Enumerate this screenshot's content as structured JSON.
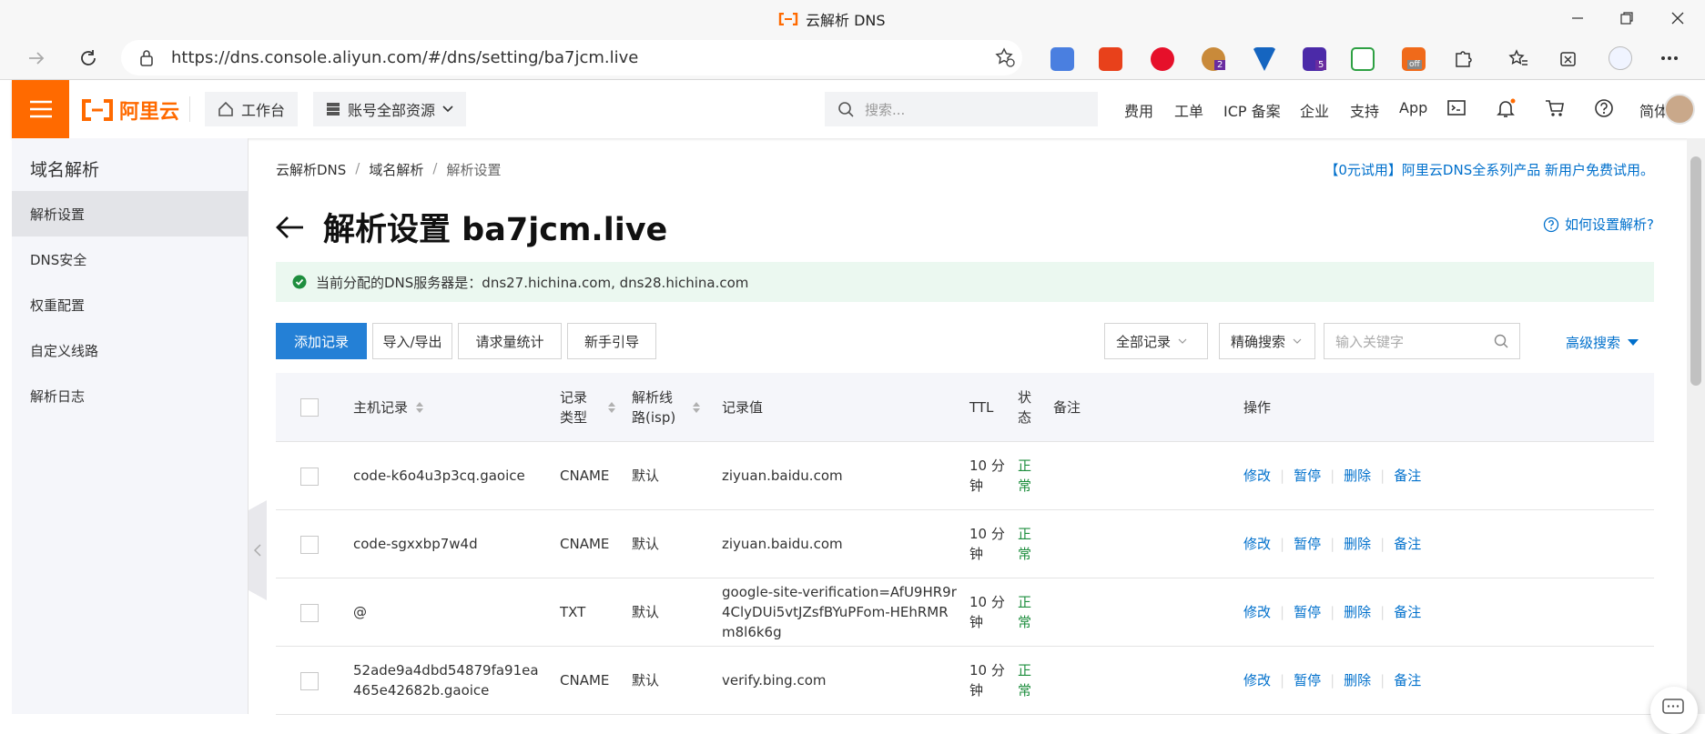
{
  "browser": {
    "window_title": "云解析 DNS",
    "url": "https://dns.console.aliyun.com/#/dns/setting/ba7jcm.live",
    "extension_badges": [
      "2",
      "5",
      "off"
    ]
  },
  "header": {
    "logo": "阿里云",
    "workbench": "工作台",
    "resources": "账号全部资源",
    "search_placeholder": "搜索...",
    "links": [
      "费用",
      "工单",
      "ICP 备案",
      "企业",
      "支持",
      "App"
    ],
    "language": "简体"
  },
  "sidebar": {
    "title": "域名解析",
    "items": [
      {
        "label": "解析设置",
        "active": true
      },
      {
        "label": "DNS安全",
        "active": false
      },
      {
        "label": "权重配置",
        "active": false
      },
      {
        "label": "自定义线路",
        "active": false
      },
      {
        "label": "解析日志",
        "active": false
      }
    ]
  },
  "breadcrumb": [
    "云解析DNS",
    "域名解析",
    "解析设置"
  ],
  "promo": "【0元试用】阿里云DNS全系列产品 新用户免费试用。",
  "page_title": "解析设置 ba7jcm.live",
  "help_link": "如何设置解析?",
  "dns_banner": "当前分配的DNS服务器是：dns27.hichina.com, dns28.hichina.com",
  "toolbar": {
    "add": "添加记录",
    "import_export": "导入/导出",
    "stats": "请求量统计",
    "guide": "新手引导",
    "filter_select": "全部记录",
    "match_select": "精确搜索",
    "keyword_placeholder": "输入关键字",
    "advanced": "高级搜索"
  },
  "table": {
    "headers": {
      "host": "主机记录",
      "type": "记录类型",
      "line": "解析线路(isp)",
      "value": "记录值",
      "ttl": "TTL",
      "status": "状态",
      "remark": "备注",
      "actions": "操作"
    },
    "actions": [
      "修改",
      "暂停",
      "删除",
      "备注"
    ],
    "rows": [
      {
        "host": "code-k6o4u3p3cq.gaoice",
        "type": "CNAME",
        "line": "默认",
        "value": "ziyuan.baidu.com",
        "ttl": "10 分钟",
        "status": "正常"
      },
      {
        "host": "code-sgxxbp7w4d",
        "type": "CNAME",
        "line": "默认",
        "value": "ziyuan.baidu.com",
        "ttl": "10 分钟",
        "status": "正常"
      },
      {
        "host": "@",
        "type": "TXT",
        "line": "默认",
        "value": "google-site-verification=AfU9HR9r4ClyDUi5vtJZsfBYuPFom-HEhRMRm8l6k6g",
        "ttl": "10 分钟",
        "status": "正常"
      },
      {
        "host": "52ade9a4dbd54879fa91ea465e42682b.gaoice",
        "type": "CNAME",
        "line": "默认",
        "value": "verify.bing.com",
        "ttl": "10 分钟",
        "status": "正常"
      }
    ]
  },
  "colors": {
    "brand": "#ff6a00",
    "primary": "#2480d6",
    "link": "#0070cc",
    "success": "#1e8e3e"
  }
}
